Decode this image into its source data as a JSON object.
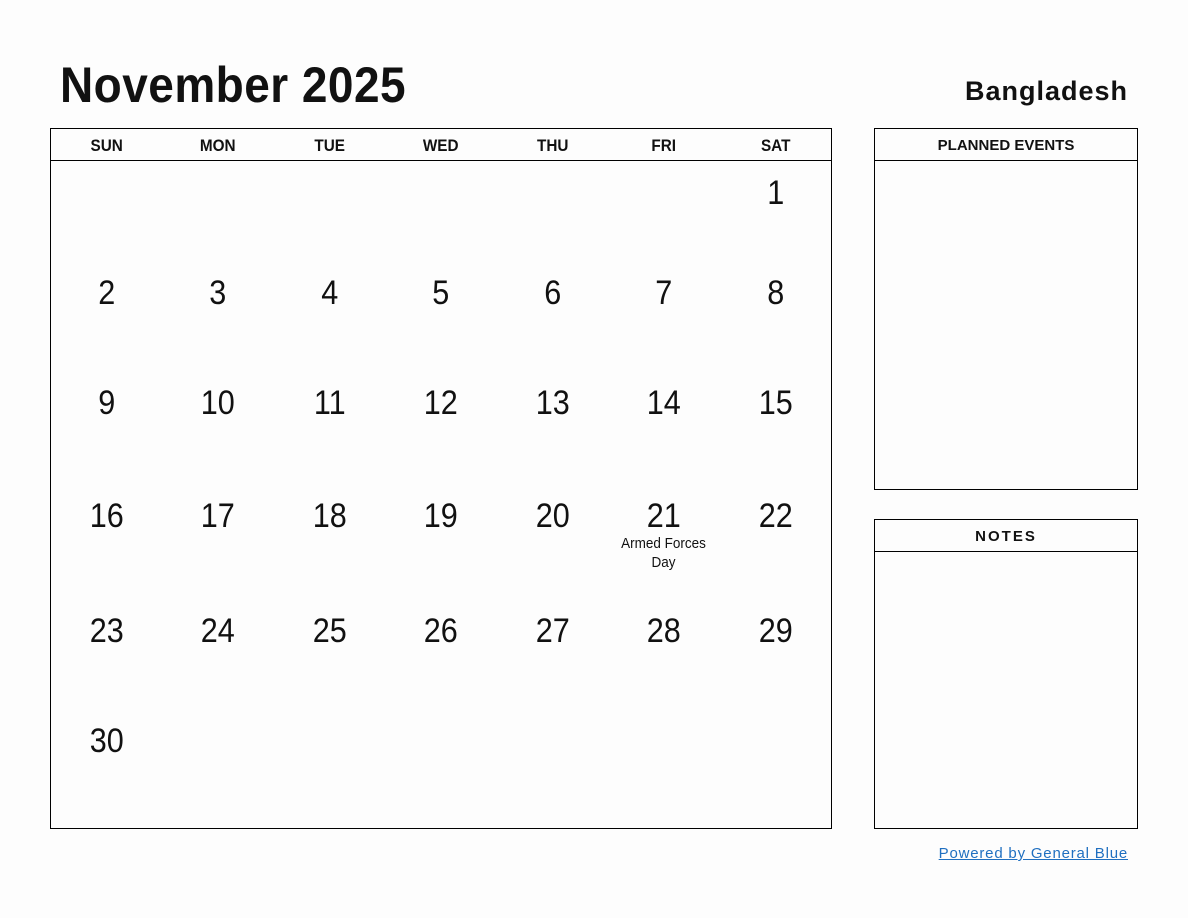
{
  "header": {
    "title": "November 2025",
    "country": "Bangladesh"
  },
  "weekdays": [
    "SUN",
    "MON",
    "TUE",
    "WED",
    "THU",
    "FRI",
    "SAT"
  ],
  "days": [
    {
      "n": "",
      "e": ""
    },
    {
      "n": "",
      "e": ""
    },
    {
      "n": "",
      "e": ""
    },
    {
      "n": "",
      "e": ""
    },
    {
      "n": "",
      "e": ""
    },
    {
      "n": "",
      "e": ""
    },
    {
      "n": "1",
      "e": ""
    },
    {
      "n": "2",
      "e": ""
    },
    {
      "n": "3",
      "e": ""
    },
    {
      "n": "4",
      "e": ""
    },
    {
      "n": "5",
      "e": ""
    },
    {
      "n": "6",
      "e": ""
    },
    {
      "n": "7",
      "e": ""
    },
    {
      "n": "8",
      "e": ""
    },
    {
      "n": "9",
      "e": ""
    },
    {
      "n": "10",
      "e": ""
    },
    {
      "n": "11",
      "e": ""
    },
    {
      "n": "12",
      "e": ""
    },
    {
      "n": "13",
      "e": ""
    },
    {
      "n": "14",
      "e": ""
    },
    {
      "n": "15",
      "e": ""
    },
    {
      "n": "16",
      "e": ""
    },
    {
      "n": "17",
      "e": ""
    },
    {
      "n": "18",
      "e": ""
    },
    {
      "n": "19",
      "e": ""
    },
    {
      "n": "20",
      "e": ""
    },
    {
      "n": "21",
      "e": "Armed Forces Day"
    },
    {
      "n": "22",
      "e": ""
    },
    {
      "n": "23",
      "e": ""
    },
    {
      "n": "24",
      "e": ""
    },
    {
      "n": "25",
      "e": ""
    },
    {
      "n": "26",
      "e": ""
    },
    {
      "n": "27",
      "e": ""
    },
    {
      "n": "28",
      "e": ""
    },
    {
      "n": "29",
      "e": ""
    },
    {
      "n": "30",
      "e": ""
    },
    {
      "n": "",
      "e": ""
    },
    {
      "n": "",
      "e": ""
    },
    {
      "n": "",
      "e": ""
    },
    {
      "n": "",
      "e": ""
    },
    {
      "n": "",
      "e": ""
    },
    {
      "n": "",
      "e": ""
    }
  ],
  "sidebar": {
    "planned_label": "PLANNED EVENTS",
    "notes_label": "NOTES"
  },
  "footer": {
    "powered": "Powered by General Blue",
    "link_color": "#1f6fc0"
  }
}
